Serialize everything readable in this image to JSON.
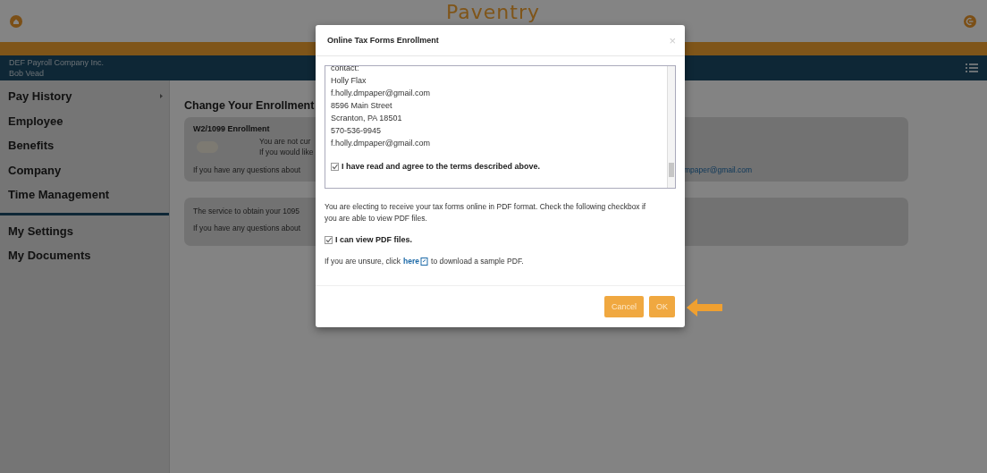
{
  "header": {
    "logo": "Paventry"
  },
  "account": {
    "company": "DEF Payroll Company Inc.",
    "user": "Bob Vead"
  },
  "sidebar": {
    "groups": [
      [
        {
          "label": "Pay History",
          "submenu": true
        },
        {
          "label": "Employee",
          "submenu": false
        },
        {
          "label": "Benefits",
          "submenu": false
        },
        {
          "label": "Company",
          "submenu": false
        },
        {
          "label": "Time Management",
          "submenu": false
        }
      ],
      [
        {
          "label": "My Settings",
          "submenu": false
        },
        {
          "label": "My Documents",
          "submenu": false
        }
      ]
    ]
  },
  "content": {
    "title": "Change Your Enrollment",
    "cards": [
      {
        "title": "W2/1099 Enrollment",
        "toggle": {
          "on": false
        },
        "lines": [
          "You are not cur",
          "If you would like"
        ],
        "footer": "If you have any questions about",
        "footer_link": "mpaper@gmail.com"
      },
      {
        "lines": [
          "The service to obtain your 1095",
          "If you have any questions about"
        ]
      }
    ]
  },
  "modal": {
    "title": "Online Tax Forms Enrollment",
    "close": "×",
    "terms_lines": [
      "contact:",
      "Holly Flax",
      "f.holly.dmpaper@gmail.com",
      "8596 Main Street",
      "Scranton, PA 18501",
      "570-536-9945",
      "f.holly.dmpaper@gmail.com"
    ],
    "agree": {
      "label": "I have read and agree to the terms described above.",
      "checked": true
    },
    "paragraph": "You are electing to receive your tax forms online in PDF format. Check the following checkbox if you are able to view PDF files.",
    "pdf_check": {
      "label": "I can view PDF files.",
      "checked": true
    },
    "sample": {
      "before": "If you are unsure, click",
      "link": "here",
      "after": "to download a sample PDF."
    },
    "buttons": [
      {
        "label": "Cancel"
      },
      {
        "label": "OK"
      }
    ]
  }
}
